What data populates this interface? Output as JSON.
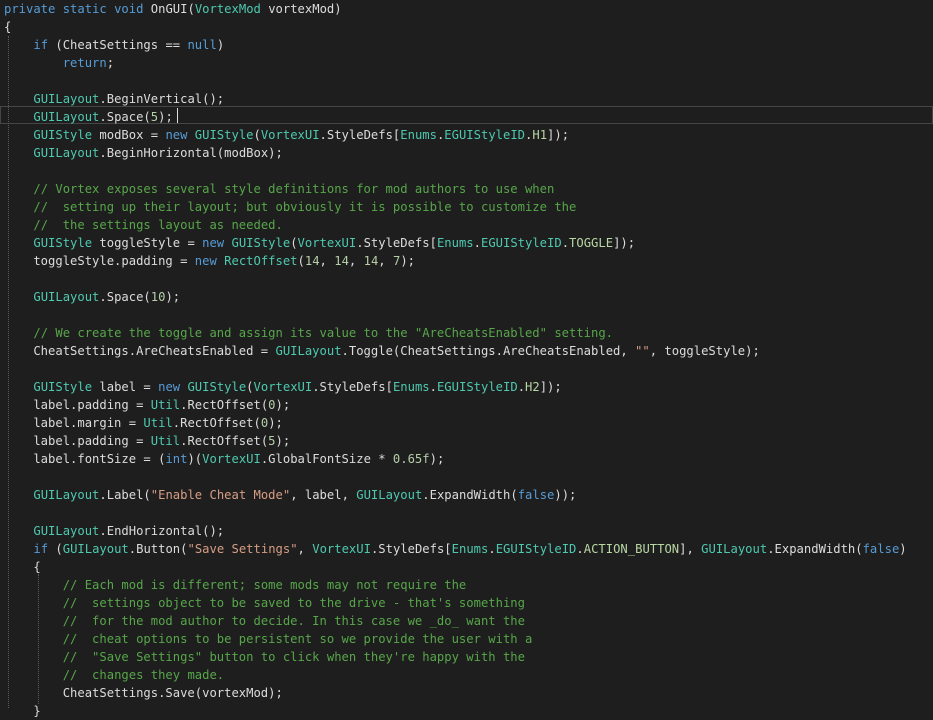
{
  "editor": {
    "lines": [
      [
        [
          "kw",
          "private"
        ],
        [
          "pl",
          " "
        ],
        [
          "kw",
          "static"
        ],
        [
          "pl",
          " "
        ],
        [
          "kw",
          "void"
        ],
        [
          "pl",
          " OnGUI("
        ],
        [
          "ty",
          "VortexMod"
        ],
        [
          "pl",
          " vortexMod)"
        ]
      ],
      [
        [
          "pl",
          "{"
        ]
      ],
      [
        [
          "pl",
          "    "
        ],
        [
          "kw",
          "if"
        ],
        [
          "pl",
          " (CheatSettings == "
        ],
        [
          "kw",
          "null"
        ],
        [
          "pl",
          ")"
        ]
      ],
      [
        [
          "pl",
          "        "
        ],
        [
          "kw",
          "return"
        ],
        [
          "pl",
          ";"
        ]
      ],
      [],
      [
        [
          "pl",
          "    "
        ],
        [
          "ty",
          "GUILayout"
        ],
        [
          "pl",
          ".BeginVertical();"
        ]
      ],
      [
        [
          "pl",
          "    "
        ],
        [
          "ty",
          "GUILayout"
        ],
        [
          "pl",
          ".Space("
        ],
        [
          "num",
          "5"
        ],
        [
          "pl",
          ");"
        ]
      ],
      [
        [
          "pl",
          "    "
        ],
        [
          "ty",
          "GUIStyle"
        ],
        [
          "pl",
          " modBox = "
        ],
        [
          "kw",
          "new"
        ],
        [
          "pl",
          " "
        ],
        [
          "ty",
          "GUIStyle"
        ],
        [
          "pl",
          "("
        ],
        [
          "ty",
          "VortexUI"
        ],
        [
          "pl",
          ".StyleDefs["
        ],
        [
          "ty",
          "Enums"
        ],
        [
          "pl",
          "."
        ],
        [
          "ty",
          "EGUIStyleID"
        ],
        [
          "pl",
          "."
        ],
        [
          "en",
          "H1"
        ],
        [
          "pl",
          "]);"
        ]
      ],
      [
        [
          "pl",
          "    "
        ],
        [
          "ty",
          "GUILayout"
        ],
        [
          "pl",
          ".BeginHorizontal(modBox);"
        ]
      ],
      [],
      [
        [
          "pl",
          "    "
        ],
        [
          "cm",
          "// Vortex exposes several style definitions for mod authors to use when"
        ]
      ],
      [
        [
          "pl",
          "    "
        ],
        [
          "cm",
          "//  setting up their layout; but obviously it is possible to customize the"
        ]
      ],
      [
        [
          "pl",
          "    "
        ],
        [
          "cm",
          "//  the settings layout as needed."
        ]
      ],
      [
        [
          "pl",
          "    "
        ],
        [
          "ty",
          "GUIStyle"
        ],
        [
          "pl",
          " toggleStyle = "
        ],
        [
          "kw",
          "new"
        ],
        [
          "pl",
          " "
        ],
        [
          "ty",
          "GUIStyle"
        ],
        [
          "pl",
          "("
        ],
        [
          "ty",
          "VortexUI"
        ],
        [
          "pl",
          ".StyleDefs["
        ],
        [
          "ty",
          "Enums"
        ],
        [
          "pl",
          "."
        ],
        [
          "ty",
          "EGUIStyleID"
        ],
        [
          "pl",
          "."
        ],
        [
          "en",
          "TOGGLE"
        ],
        [
          "pl",
          "]);"
        ]
      ],
      [
        [
          "pl",
          "    toggleStyle.padding = "
        ],
        [
          "kw",
          "new"
        ],
        [
          "pl",
          " "
        ],
        [
          "ty",
          "RectOffset"
        ],
        [
          "pl",
          "("
        ],
        [
          "num",
          "14"
        ],
        [
          "pl",
          ", "
        ],
        [
          "num",
          "14"
        ],
        [
          "pl",
          ", "
        ],
        [
          "num",
          "14"
        ],
        [
          "pl",
          ", "
        ],
        [
          "num",
          "7"
        ],
        [
          "pl",
          ");"
        ]
      ],
      [],
      [
        [
          "pl",
          "    "
        ],
        [
          "ty",
          "GUILayout"
        ],
        [
          "pl",
          ".Space("
        ],
        [
          "num",
          "10"
        ],
        [
          "pl",
          ");"
        ]
      ],
      [],
      [
        [
          "pl",
          "    "
        ],
        [
          "cm",
          "// We create the toggle and assign its value to the \"AreCheatsEnabled\" setting."
        ]
      ],
      [
        [
          "pl",
          "    CheatSettings.AreCheatsEnabled = "
        ],
        [
          "ty",
          "GUILayout"
        ],
        [
          "pl",
          ".Toggle(CheatSettings.AreCheatsEnabled, "
        ],
        [
          "str",
          "\"\""
        ],
        [
          "pl",
          ", toggleStyle);"
        ]
      ],
      [],
      [
        [
          "pl",
          "    "
        ],
        [
          "ty",
          "GUIStyle"
        ],
        [
          "pl",
          " label = "
        ],
        [
          "kw",
          "new"
        ],
        [
          "pl",
          " "
        ],
        [
          "ty",
          "GUIStyle"
        ],
        [
          "pl",
          "("
        ],
        [
          "ty",
          "VortexUI"
        ],
        [
          "pl",
          ".StyleDefs["
        ],
        [
          "ty",
          "Enums"
        ],
        [
          "pl",
          "."
        ],
        [
          "ty",
          "EGUIStyleID"
        ],
        [
          "pl",
          "."
        ],
        [
          "en",
          "H2"
        ],
        [
          "pl",
          "]);"
        ]
      ],
      [
        [
          "pl",
          "    label.padding = "
        ],
        [
          "ty",
          "Util"
        ],
        [
          "pl",
          ".RectOffset("
        ],
        [
          "num",
          "0"
        ],
        [
          "pl",
          ");"
        ]
      ],
      [
        [
          "pl",
          "    label.margin = "
        ],
        [
          "ty",
          "Util"
        ],
        [
          "pl",
          ".RectOffset("
        ],
        [
          "num",
          "0"
        ],
        [
          "pl",
          ");"
        ]
      ],
      [
        [
          "pl",
          "    label.padding = "
        ],
        [
          "ty",
          "Util"
        ],
        [
          "pl",
          ".RectOffset("
        ],
        [
          "num",
          "5"
        ],
        [
          "pl",
          ");"
        ]
      ],
      [
        [
          "pl",
          "    label.fontSize = ("
        ],
        [
          "kw",
          "int"
        ],
        [
          "pl",
          ")("
        ],
        [
          "ty",
          "VortexUI"
        ],
        [
          "pl",
          ".GlobalFontSize * "
        ],
        [
          "num",
          "0.65f"
        ],
        [
          "pl",
          ");"
        ]
      ],
      [],
      [
        [
          "pl",
          "    "
        ],
        [
          "ty",
          "GUILayout"
        ],
        [
          "pl",
          ".Label("
        ],
        [
          "str",
          "\"Enable Cheat Mode\""
        ],
        [
          "pl",
          ", label, "
        ],
        [
          "ty",
          "GUILayout"
        ],
        [
          "pl",
          ".ExpandWidth("
        ],
        [
          "kw",
          "false"
        ],
        [
          "pl",
          "));"
        ]
      ],
      [],
      [
        [
          "pl",
          "    "
        ],
        [
          "ty",
          "GUILayout"
        ],
        [
          "pl",
          ".EndHorizontal();"
        ]
      ],
      [
        [
          "pl",
          "    "
        ],
        [
          "kw",
          "if"
        ],
        [
          "pl",
          " ("
        ],
        [
          "ty",
          "GUILayout"
        ],
        [
          "pl",
          ".Button("
        ],
        [
          "str",
          "\"Save Settings\""
        ],
        [
          "pl",
          ", "
        ],
        [
          "ty",
          "VortexUI"
        ],
        [
          "pl",
          ".StyleDefs["
        ],
        [
          "ty",
          "Enums"
        ],
        [
          "pl",
          "."
        ],
        [
          "ty",
          "EGUIStyleID"
        ],
        [
          "pl",
          "."
        ],
        [
          "en",
          "ACTION_BUTTON"
        ],
        [
          "pl",
          "], "
        ],
        [
          "ty",
          "GUILayout"
        ],
        [
          "pl",
          ".ExpandWidth("
        ],
        [
          "kw",
          "false"
        ],
        [
          "pl",
          ")"
        ]
      ],
      [
        [
          "pl",
          "    {"
        ]
      ],
      [
        [
          "pl",
          "        "
        ],
        [
          "cm",
          "// Each mod is different; some mods may not require the"
        ]
      ],
      [
        [
          "pl",
          "        "
        ],
        [
          "cm",
          "//  settings object to be saved to the drive - that's something"
        ]
      ],
      [
        [
          "pl",
          "        "
        ],
        [
          "cm",
          "//  for the mod author to decide. In this case we _do_ want the"
        ]
      ],
      [
        [
          "pl",
          "        "
        ],
        [
          "cm",
          "//  cheat options to be persistent so we provide the user with a"
        ]
      ],
      [
        [
          "pl",
          "        "
        ],
        [
          "cm",
          "//  \"Save Settings\" button to click when they're happy with the"
        ]
      ],
      [
        [
          "pl",
          "        "
        ],
        [
          "cm",
          "//  changes they made."
        ]
      ],
      [
        [
          "pl",
          "        CheatSettings.Save(vortexMod);"
        ]
      ],
      [
        [
          "pl",
          "    }"
        ]
      ]
    ]
  },
  "colors": {
    "background": "#1e1e1e",
    "keyword": "#569cd6",
    "type": "#4ec9b0",
    "plain": "#dcdcdc",
    "number": "#b5cea8",
    "string": "#d69d85",
    "comment": "#57a64a",
    "enum_member": "#b8d7a3"
  }
}
